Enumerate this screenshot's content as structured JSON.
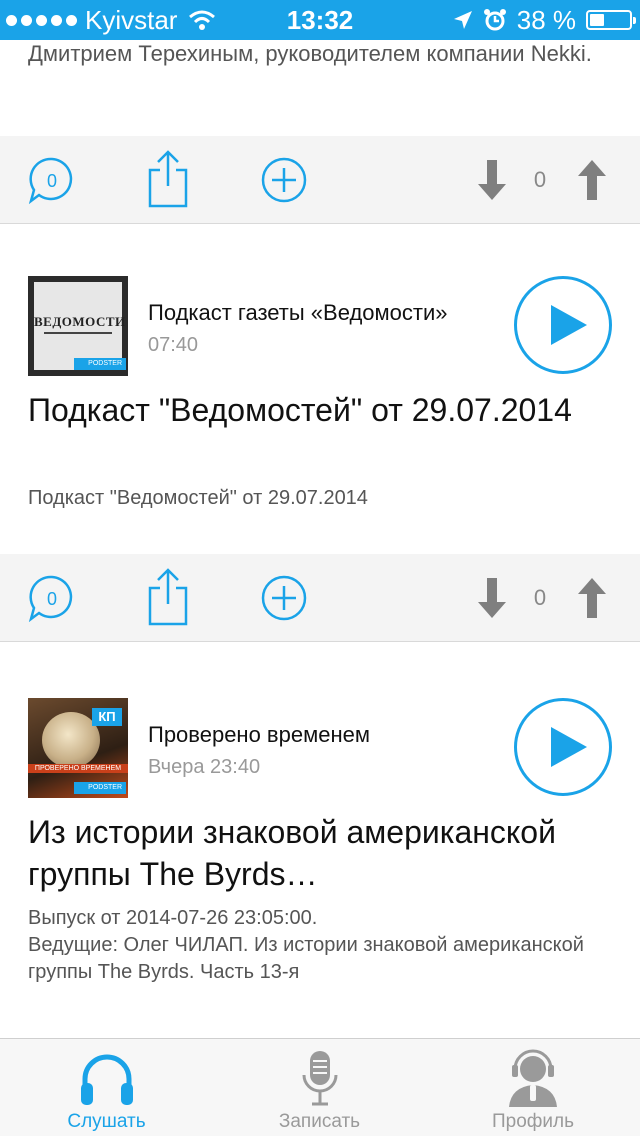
{
  "status_bar": {
    "carrier": "Kyivstar",
    "time": "13:32",
    "battery": "38 %",
    "battery_level": 0.38
  },
  "feed": {
    "top_snippet": "Дмитрием Терехиным, руководителем компании Nekki.",
    "action_bars": [
      {
        "comments": "0",
        "votes": "0"
      },
      {
        "comments": "0",
        "votes": "0"
      }
    ],
    "episodes": [
      {
        "podcast": "Подкаст газеты «Ведомости»",
        "time": "07:40",
        "title": "Подкаст \"Ведомостей\" от 29.07.2014",
        "description": "Подкаст \"Ведомостей\" от 29.07.2014",
        "thumb_text": "ВЕДОМОСТИ",
        "thumb_badge": "PODSTER"
      },
      {
        "podcast": "Проверено временем",
        "time": "Вчера 23:40",
        "title": "Из истории знаковой американской группы The Byrds…",
        "description": "Выпуск от 2014-07-26 23:05:00.\n   Ведущие: Олег ЧИЛАП. Из истории знаковой американской группы The Byrds. Часть 13-я",
        "thumb_text": "ПРОВЕРЕНО ВРЕМЕНЕМ",
        "thumb_badge": "PODSTER",
        "thumb_logo": "КП"
      }
    ]
  },
  "tab_bar": {
    "tabs": [
      {
        "label": "Слушать",
        "icon": "headphones-icon",
        "active": true
      },
      {
        "label": "Записать",
        "icon": "microphone-icon",
        "active": false
      },
      {
        "label": "Профиль",
        "icon": "profile-icon",
        "active": false
      }
    ]
  },
  "colors": {
    "accent": "#1aa3e8",
    "inactive": "#9a9a9a",
    "action_bar_bg": "#f4f4f4"
  }
}
